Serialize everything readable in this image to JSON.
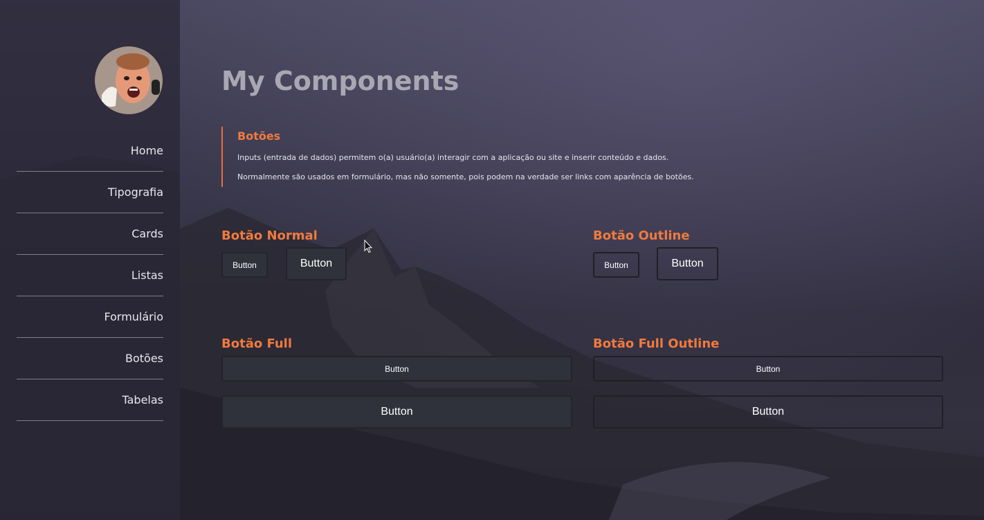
{
  "sidebar": {
    "nav": [
      {
        "label": "Home"
      },
      {
        "label": "Tipografia"
      },
      {
        "label": "Cards"
      },
      {
        "label": "Listas"
      },
      {
        "label": "Formulário"
      },
      {
        "label": "Botões"
      },
      {
        "label": "Tabelas"
      }
    ]
  },
  "main": {
    "title": "My Components",
    "callout": {
      "heading": "Botões",
      "paragraph1": "Inputs (entrada de dados) permitem o(a) usuário(a) interagir com a aplicação ou site e inserir conteúdo e dados.",
      "paragraph2": "Normalmente são usados em formulário, mas não somente, pois podem na verdade ser links com aparência de botões."
    },
    "sections": {
      "normal": {
        "title": "Botão Normal",
        "small_button": "Button",
        "large_button": "Button"
      },
      "outline": {
        "title": "Botão Outline",
        "small_button": "Button",
        "large_button": "Button"
      },
      "full": {
        "title": "Botão Full",
        "small_button": "Button",
        "large_button": "Button"
      },
      "full_outline": {
        "title": "Botão Full Outline",
        "small_button": "Button",
        "large_button": "Button"
      }
    }
  },
  "colors": {
    "accent": "#f07a3e",
    "button_bg": "#2f323a",
    "sidebar_bg": "#2a2836",
    "title": "#a9a8b2"
  }
}
